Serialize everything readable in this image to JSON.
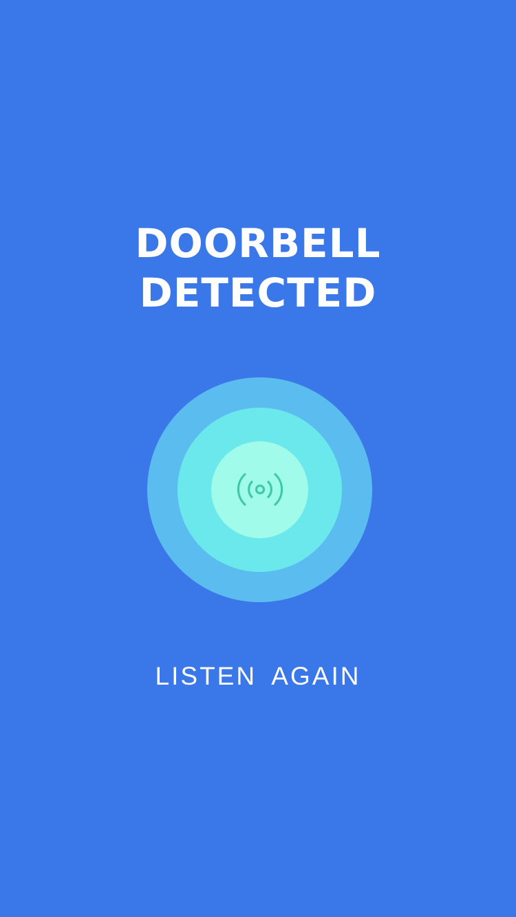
{
  "alert": {
    "title_line1": "DOORBELL",
    "title_line2": "DETECTED"
  },
  "indicator": {
    "icon": "broadcast-icon"
  },
  "actions": {
    "listen_again_label": "LISTEN AGAIN"
  },
  "colors": {
    "background": "#3a77e8",
    "ring_outer": "#5bbcef",
    "ring_middle": "#6ae8ec",
    "ring_inner": "#a0fbea",
    "icon": "#3fc9a8",
    "text": "#ffffff"
  }
}
